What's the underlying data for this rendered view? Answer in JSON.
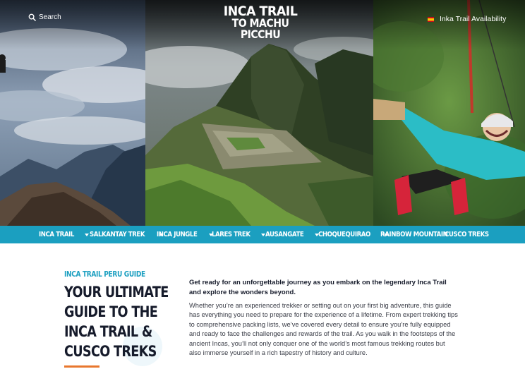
{
  "header": {
    "search_label": "Search",
    "logo_line1": "INCA TRAIL",
    "logo_line2": "TO MACHU PICCHU",
    "availability_label": "Inka Trail Availability"
  },
  "nav": {
    "items": [
      {
        "label": "INCA TRAIL",
        "has_dropdown": true
      },
      {
        "label": "SALKANTAY TREK",
        "has_dropdown": true
      },
      {
        "label": "INCA JUNGLE",
        "has_dropdown": true
      },
      {
        "label": "LARES TREK",
        "has_dropdown": true
      },
      {
        "label": "AUSANGATE",
        "has_dropdown": true
      },
      {
        "label": "CHOQUEQUIRAO",
        "has_dropdown": true
      },
      {
        "label": "RAINBOW MOUNTAIN",
        "has_dropdown": false
      },
      {
        "label": "CUSCO TREKS",
        "has_dropdown": false
      }
    ]
  },
  "intro": {
    "eyebrow": "INCA TRAIL PERU GUIDE",
    "headline_lines": [
      "YOUR ULTIMATE",
      "GUIDE TO THE",
      "INCA TRAIL &",
      "CUSCO TREKS"
    ],
    "lead": "Get ready for an unforgettable journey as you embark on the legendary Inca Trail and explore the wonders beyond.",
    "body": "Whether you’re an experienced trekker or setting out on your first big adventure, this guide has everything you need to prepare for the experience of a lifetime. From expert trekking tips to comprehensive packing lists, we’ve covered every detail to ensure you’re fully equipped and ready to face the challenges and rewards of the trail. As you walk in the footsteps of the ancient Incas, you’ll not only conquer one of the world’s most famous trekking routes but also immerse yourself in a rich tapestry of history and culture."
  },
  "colors": {
    "nav_background": "#1b9fc0",
    "eyebrow": "#1b9fc0",
    "headline": "#161b2b",
    "accent_underline": "#e8772e"
  },
  "icons": {
    "search": "search-icon",
    "availability": "spain-flag-icon",
    "dropdown": "caret-down-icon"
  }
}
